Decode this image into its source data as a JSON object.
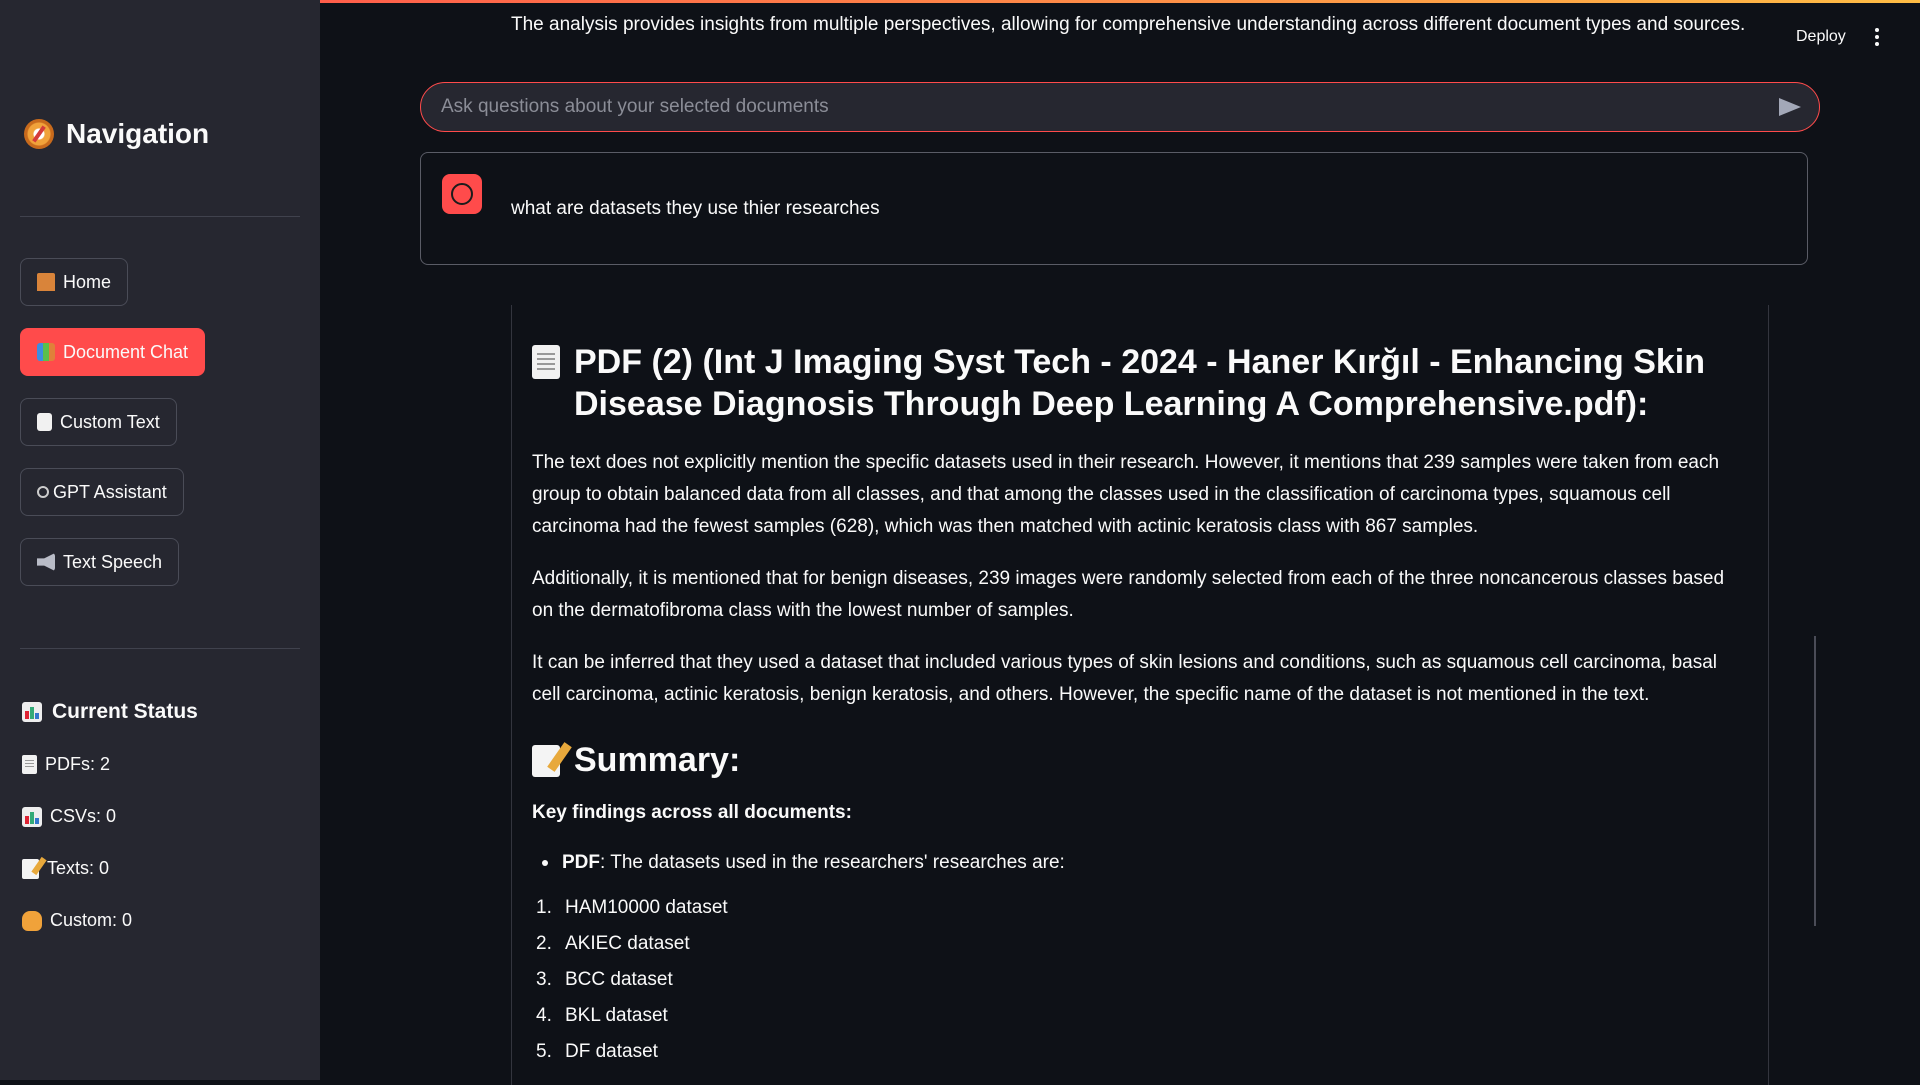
{
  "header": {
    "top_text": "The analysis provides insights from multiple perspectives, allowing for comprehensive understanding across different document types and sources.",
    "deploy_label": "Deploy"
  },
  "sidebar": {
    "title": "Navigation",
    "nav": [
      {
        "label": "Home",
        "icon": "house-icon"
      },
      {
        "label": "Document Chat",
        "icon": "books-icon",
        "active": true
      },
      {
        "label": "Custom Text",
        "icon": "memo-icon"
      },
      {
        "label": "GPT Assistant",
        "icon": "robot-icon"
      },
      {
        "label": "Text Speech",
        "icon": "speaker-icon"
      }
    ],
    "status_title": "Current Status",
    "status": [
      {
        "label": "PDFs: 2",
        "icon": "document-icon"
      },
      {
        "label": "CSVs: 0",
        "icon": "chart-icon"
      },
      {
        "label": "Texts: 0",
        "icon": "memo-icon"
      },
      {
        "label": "Custom: 0",
        "icon": "writing-hand-icon"
      }
    ]
  },
  "chat": {
    "input_placeholder": "Ask questions about your selected documents",
    "user_message": "what are datasets they use thier researches"
  },
  "answer": {
    "doc_title": "PDF (2) (Int J Imaging Syst Tech - 2024 - Haner Kırğıl - Enhancing Skin Disease Diagnosis Through Deep Learning A Comprehensive.pdf):",
    "paragraphs": [
      "The text does not explicitly mention the specific datasets used in their research. However, it mentions that 239 samples were taken from each group to obtain balanced data from all classes, and that among the classes used in the classification of carcinoma types, squamous cell carcinoma had the fewest samples (628), which was then matched with actinic keratosis class with 867 samples.",
      "Additionally, it is mentioned that for benign diseases, 239 images were randomly selected from each of the three noncancerous classes based on the dermatofibroma class with the lowest number of samples.",
      "It can be inferred that they used a dataset that included various types of skin lesions and conditions, such as squamous cell carcinoma, basal cell carcinoma, actinic keratosis, benign keratosis, and others. However, the specific name of the dataset is not mentioned in the text."
    ],
    "summary_title": "Summary:",
    "key_findings": "Key findings across all documents:",
    "bullet_bold": "PDF",
    "bullet_text": ": The datasets used in the researchers' researches are:",
    "datasets": [
      {
        "num": "1.",
        "name": "HAM10000 dataset"
      },
      {
        "num": "2.",
        "name": "AKIEC dataset"
      },
      {
        "num": "3.",
        "name": "BCC dataset"
      },
      {
        "num": "4.",
        "name": "BKL dataset"
      },
      {
        "num": "5.",
        "name": "DF dataset"
      }
    ]
  },
  "colors": {
    "accent": "#ff4b4b",
    "sidebar": "#262730",
    "background": "#0e1117"
  }
}
